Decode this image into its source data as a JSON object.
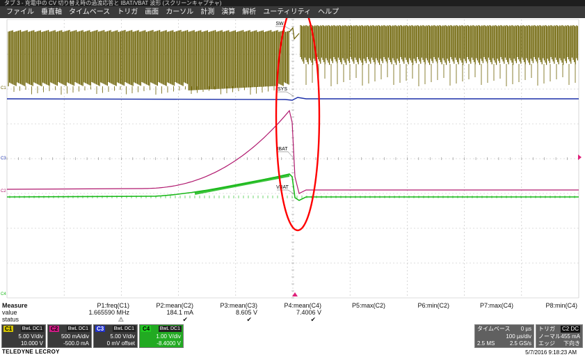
{
  "window": {
    "title_strip": "タブ 3 - 充電中の CV 切り替え時の過渡応答と IBAT/VBAT 波形 (スクリーンキャプチャ)"
  },
  "menu": {
    "items": [
      "ファイル",
      "垂直軸",
      "タイムベース",
      "トリガ",
      "画面",
      "カーソル",
      "計測",
      "演算",
      "解析",
      "ユーティリティ",
      "ヘルプ"
    ]
  },
  "traces": {
    "labels": {
      "sw": "SW",
      "sys": "SYS",
      "ibat": "IBAT",
      "vbat": "VBAT"
    },
    "ground_markers": [
      "C1",
      "C3",
      "C2",
      "C4"
    ],
    "colors": {
      "c1": "#6b6000",
      "c2": "#b0186e",
      "c3": "#1a2ea8",
      "c4": "#18b818",
      "annotation": "#ff0000",
      "grid": "#bdbdbd"
    }
  },
  "measure": {
    "header": "Measure",
    "row_labels": [
      "value",
      "status"
    ],
    "params": [
      {
        "name": "P1:freq(C1)",
        "value": "1.665590 MHz",
        "status": "⚠"
      },
      {
        "name": "P2:mean(C2)",
        "value": "184.1 mA",
        "status": "✔"
      },
      {
        "name": "P3:mean(C3)",
        "value": "8.605 V",
        "status": "✔"
      },
      {
        "name": "P4:mean(C4)",
        "value": "7.4006 V",
        "status": "✔"
      },
      {
        "name": "P5:max(C2)",
        "value": "",
        "status": ""
      },
      {
        "name": "P6:min(C2)",
        "value": "",
        "status": ""
      },
      {
        "name": "P7:max(C4)",
        "value": "",
        "status": ""
      },
      {
        "name": "P8:min(C4)",
        "value": "",
        "status": ""
      }
    ]
  },
  "channels": [
    {
      "tag": "C1",
      "flags": "BwL DC1",
      "vdiv": "5.00 V/div",
      "offset": "10.000 V",
      "color": "#d4c400"
    },
    {
      "tag": "C2",
      "flags": "BwL DC1",
      "vdiv": "500 mA/div",
      "offset": "-500.0 mA",
      "color": "#d01a86"
    },
    {
      "tag": "C3",
      "flags": "BwL DC1",
      "vdiv": "5.00 V/div",
      "offset": "0 mV offset",
      "color": "#2233cc"
    },
    {
      "tag": "C4",
      "flags": "BwL DC1",
      "vdiv": "1.00 V/div",
      "offset": "-8.4000 V",
      "color": "#22cc22"
    }
  ],
  "timebase": {
    "label": "タイムベース",
    "delay": "0 µs",
    "per_div": "100 µs/div",
    "samples": "2.5 MS",
    "rate": "2.5 GS/s"
  },
  "trigger": {
    "label": "トリガ",
    "flags": "C2 DC",
    "mode": "ノーマル",
    "level": "455 mA",
    "type": "エッジ",
    "slope": "下向き"
  },
  "brand": "TELEDYNE LECROY",
  "timestamp": "5/7/2016 9:18:23 AM"
}
